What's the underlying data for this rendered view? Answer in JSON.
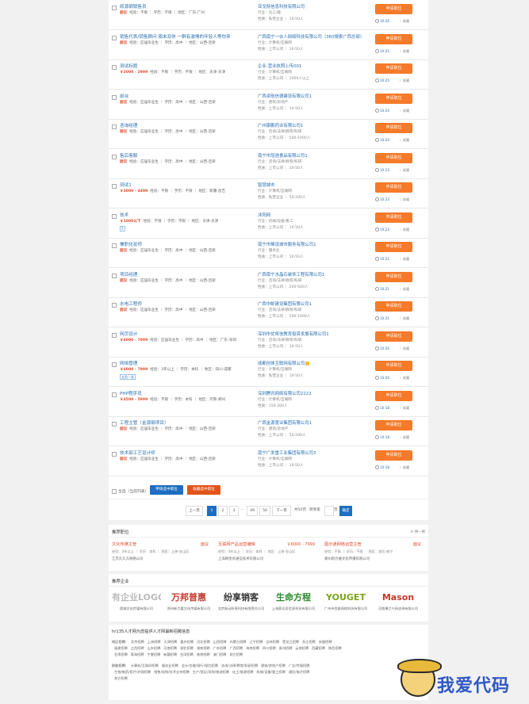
{
  "jobs": [
    {
      "title": "硕源钢销售员",
      "salary": "面议",
      "meta": "经验：不限 ｜ 学历：不限 ｜ 地区：广东-广州",
      "tag": "",
      "company": "亚戈特信息科技有限公司",
      "info1": "行业：化工/能",
      "info2": "性质：私营企业 ｜ 10-50人",
      "time": "10:26",
      "fav": "收藏",
      "apply": "申请职位",
      "badge": false
    },
    {
      "title": "销售代表/销售顾问 周末双休 一群有激情的年轻人等你来",
      "salary": "面议",
      "meta": "经验：应届毕业生 ｜ 学历：高中 ｜ 地区：山西-吕梁",
      "tag": "",
      "company": "广西南宁一伙人网络科技有限公司（360搜索广西总部）",
      "info1": "行业：计算机/互联网",
      "info2": "性质：上市公司 ｜ 10-50人",
      "time": "10:25",
      "fav": "收藏",
      "apply": "申请职位",
      "badge": false
    },
    {
      "title": "测试标题",
      "salary": "￥2000 - 2999",
      "meta": "经验：不限 ｜ 学历：不限 ｜ 地区：天津-天津",
      "tag": "",
      "company": "企业-营业执照上传001",
      "info1": "行业：计算机/互联网",
      "info2": "性质：上市公司 ｜ 1000人以上",
      "time": "10:25",
      "fav": "收藏",
      "apply": "申请职位",
      "badge": false
    },
    {
      "title": "前台",
      "salary": "面议",
      "meta": "经验：应届毕业生 ｜ 学历：高中 ｜ 地区：山西-吕梁",
      "tag": "",
      "company": "广西卓航信德建设有限公司1",
      "info1": "行业：建筑/房地产",
      "info2": "性质：上市公司 ｜ 10-50人",
      "time": "10:24",
      "fav": "收藏",
      "apply": "申请职位",
      "badge": false
    },
    {
      "title": "咨询经理",
      "salary": "面议",
      "meta": "经验：应届毕业生 ｜ 学历：高中 ｜ 地区：山西-吕梁",
      "tag": "",
      "company": "广州康鹏药业有限公司1",
      "info1": "行业：咨询/法律/教育/科研",
      "info2": "性质：上市公司 ｜ 500-1000人",
      "time": "10:24",
      "fav": "收藏",
      "apply": "申请职位",
      "badge": false
    },
    {
      "title": "售后客服",
      "salary": "面议",
      "meta": "经验：应届毕业生 ｜ 学历：高中 ｜ 地区：山西-吕梁",
      "tag": "",
      "company": "南宁市冠浩食品有限公司1",
      "info1": "行业：咨询/法律/教育/科研",
      "info2": "性质：上市公司 ｜ 10-50人",
      "time": "10:23",
      "fav": "收藏",
      "apply": "申请职位",
      "badge": false
    },
    {
      "title": "测试1",
      "salary": "￥3000 - 4499",
      "meta": "经验：不限 ｜ 学历：不限 ｜ 地区：新疆-昌吉",
      "tag": "",
      "company": "智慧城市",
      "info1": "行业：计算机/互联网",
      "info2": "性质：私营企业 ｜ 50-200人",
      "time": "10:23",
      "fav": "收藏",
      "apply": "申请职位",
      "badge": false
    },
    {
      "title": "技术",
      "salary": "￥1000以下",
      "meta": "经验：不限 ｜ 学历：不限 ｜ 地区：天津-天津",
      "tag": "5",
      "company": "沐阳网",
      "info1": "行业：机械/设备/重工",
      "info2": "性质：上市公司 ｜ 10-50人",
      "time": "10:23",
      "fav": "收藏",
      "apply": "申请职位",
      "badge": false
    },
    {
      "title": "兼职化妆师",
      "salary": "面议",
      "meta": "经验：应届毕业生 ｜ 学历：高中 ｜ 地区：山西-吕梁",
      "tag": "",
      "company": "南宁市稀设城市服务有限公司1",
      "info1": "行业：服务业",
      "info2": "性质：上市公司 ｜ 10-50人",
      "time": "10:22",
      "fav": "收藏",
      "apply": "申请职位",
      "badge": false
    },
    {
      "title": "项目经理",
      "salary": "面议",
      "meta": "经验：应届毕业生 ｜ 学历：高中 ｜ 地区：山西-吕梁",
      "tag": "",
      "company": "广西南宁水晶石装饰工程有限公司1",
      "info1": "行业：咨询/法律/教育/科研",
      "info2": "性质：上市公司 ｜ 200-500人",
      "time": "10:21",
      "fav": "收藏",
      "apply": "申请职位",
      "badge": false
    },
    {
      "title": "水电工程师",
      "salary": "面议",
      "meta": "经验：应届毕业生 ｜ 学历：高中 ｜ 地区：山西-吕梁",
      "tag": "",
      "company": "广西中邮建设集团有限公司1",
      "info1": "行业：咨询/法律/教育/科研",
      "info2": "性质：上市公司 ｜ 500-1000人",
      "time": "10:21",
      "fav": "收藏",
      "apply": "申请职位",
      "badge": false
    },
    {
      "title": "网页设计",
      "salary": "￥6000 - 7999",
      "meta": "经验：应届毕业生 ｜ 学历：高中 ｜ 地区：广东-深圳",
      "tag": "",
      "company": "深圳市优将信教育投资发展有限公司1",
      "info1": "行业：咨询/法律/教育/科研",
      "info2": "性质：上市公司 ｜ 10-50人",
      "time": "10:20",
      "fav": "收藏",
      "apply": "申请职位",
      "badge": false
    },
    {
      "title": "网络管理",
      "salary": "￥6000 - 7999",
      "meta": "经验：3年以上 ｜ 学历：本科 ｜ 地区：四川-成都",
      "tag": "五险一金",
      "company": "成都创体互联网有限公司",
      "info1": "行业：计算机/互联网",
      "info2": "性质：私营企业 ｜ 10-50人",
      "time": "10:20",
      "fav": "收藏",
      "apply": "申请职位",
      "badge": true
    },
    {
      "title": "PHP程序员",
      "salary": "￥4500 - 5999",
      "meta": "经验：不限 ｜ 学历：本科 ｜ 地区：河南-郑州",
      "tag": "",
      "company": "深圳腾讯网络有限公司2222",
      "info1": "行业：计算机/互联网",
      "info2": "性质：150-200人",
      "time": "10:18",
      "fav": "收藏",
      "apply": "申请职位",
      "badge": false
    },
    {
      "title": "工程主管（金源钢项目）",
      "salary": "面议",
      "meta": "经验：应届毕业生 ｜ 学历：高中 ｜ 地区：山西-吕梁",
      "tag": "",
      "company": "广西金源置业集团有限公司1",
      "info1": "行业：建筑/房地产",
      "info2": "性质：上市公司 ｜ 50-200人",
      "time": "10:18",
      "fav": "收藏",
      "apply": "申请职位",
      "badge": false
    },
    {
      "title": "技术部工艺设计师",
      "salary": "面议",
      "meta": "经验：应届毕业生 ｜ 学历：高中 ｜ 地区：山西-吕梁",
      "tag": "",
      "company": "南宁广发重工业集团有限公司3",
      "info1": "行业：计算机/互联网",
      "info2": "性质：上市公司 ｜ 10-50人",
      "time": "10:18",
      "fav": "收藏",
      "apply": "申请职位",
      "badge": false
    }
  ],
  "bulk": {
    "select_all": "全选（当前列表）",
    "apply_selected": "申请选中职位",
    "fav_selected": "收藏选中职位"
  },
  "pager": {
    "prev": "上一页",
    "pages": [
      "1",
      "2",
      "3",
      "...",
      "49",
      "50"
    ],
    "next": "下一页",
    "total": "共50页",
    "goto": "转到第",
    "page_unit": "页",
    "confirm": "确定"
  },
  "rec_jobs": {
    "title": "推荐职位",
    "refresh": "换一换",
    "items": [
      {
        "title": "文化传媒主管",
        "salary": "面议",
        "meta": "经验：3年以上 ｜ 学历：本科 ｜ 地区：上海-金山区",
        "company": "江苏久久久网络公司"
      },
      {
        "title": "互联网产品运营编辑",
        "salary": "￥6000 - 7999",
        "meta": "经验：3年以上 ｜ 学历：本科 ｜ 地区：上海-金山区",
        "company": "上海网金优通信技术有限公司"
      },
      {
        "title": "图示通网络运营主管",
        "salary": "面议",
        "meta": "经验：不限 ｜ 学历：不限 ｜ 地区：湖北-咸宁",
        "company": "郑州新力嘉文化传播有限公司"
      }
    ]
  },
  "rec_cos": {
    "title": "推荐企业",
    "items": [
      {
        "logo": "有企业LOGO",
        "name": "德城文化传媒有限公司",
        "color": "#bbbbbb"
      },
      {
        "logo": "万邦普惠",
        "name": "郑州新力嘉文化传媒有限公司",
        "color": "#c0392b"
      },
      {
        "logo": "纷享销客",
        "name": "北京易动纷享科技有限责任公司",
        "color": "#333333"
      },
      {
        "logo": "生命方程",
        "name": "上海燕志奇信息科技有限公司",
        "color": "#2e8b2e"
      },
      {
        "logo": "YOUGET",
        "name": "广州市优维网络科技有限公司",
        "color": "#7aa520"
      },
      {
        "logo": "Mason",
        "name": "河南豫之兴网咨询有限公司",
        "color": "#c0392b"
      }
    ]
  },
  "links": {
    "title": "hr135人才网为您提供人才网最新招聘信息",
    "rows": [
      [
        "地区招聘：",
        "北京招聘",
        "上海招聘",
        "天津招聘",
        "重庆招聘",
        "河北招聘",
        "山西招聘",
        "内蒙古招聘",
        "辽宁招聘",
        "吉林招聘",
        "黑龙江招聘",
        "浙江招聘",
        "安徽招聘"
      ],
      [
        "",
        "福建招聘",
        "江西招聘",
        "山东招聘",
        "河南招聘",
        "湖北招聘",
        "湖南招聘",
        "广东招聘",
        "广西招聘",
        "海南招聘",
        "四川招聘",
        "贵州招聘",
        "云南招聘",
        "西藏招聘",
        "陕西招聘"
      ],
      [
        "",
        "甘肃招聘",
        "青海招聘",
        "宁夏招聘",
        "新疆招聘",
        "台湾招聘",
        "香港招聘",
        "澳门招聘",
        "其它招聘"
      ],
      [
        "职能招聘：",
        "计算机/互联网招聘",
        "服务业招聘",
        "会计/金融/银行/保险招聘",
        "咨询/法律/教育/科研招聘",
        "建筑/房地产招聘",
        "广告/传媒招聘"
      ],
      [
        "",
        "生物/制药/医疗/护理招聘",
        "销售/采购/技术支持招聘",
        "生产/营运/采购/物流招聘",
        "化工/能源招聘",
        "机械/设备/重工招聘",
        "通信/电子招聘"
      ],
      [
        "",
        "其它招聘"
      ]
    ]
  },
  "watermark": "我爱代码"
}
